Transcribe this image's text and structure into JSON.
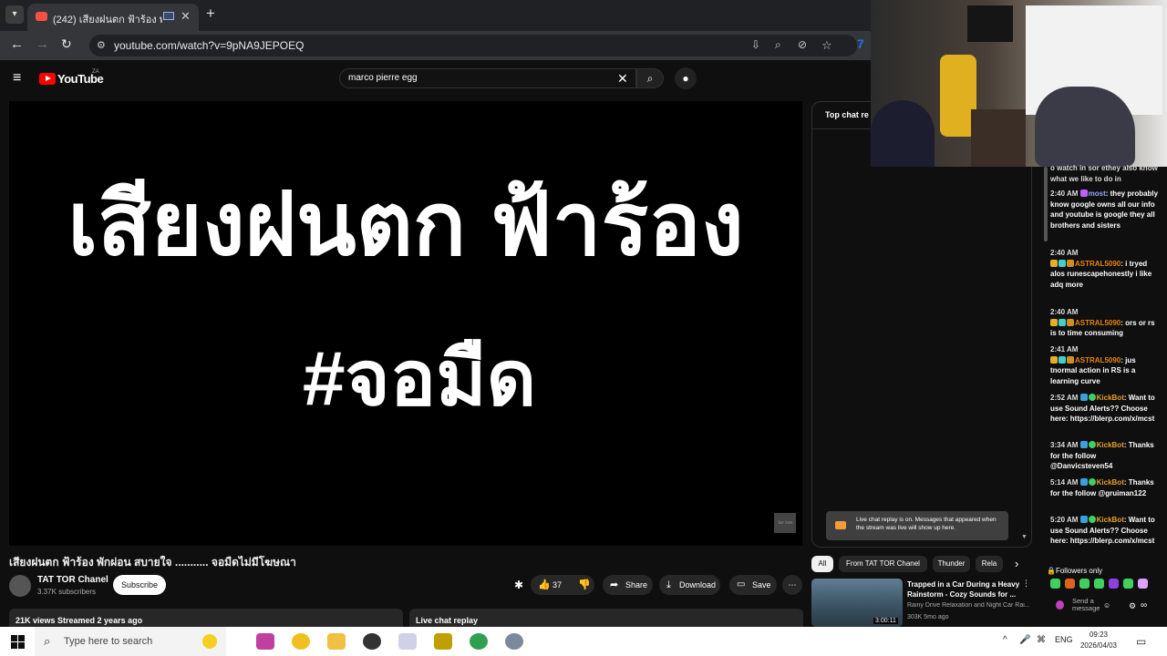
{
  "browser": {
    "tab_title": "(242) เสียงฝนตก ฟ้าร้อง พักผ่อน",
    "url": "youtube.com/watch?v=9pNA9JEPOEQ"
  },
  "youtube": {
    "logo_text": "YouTube",
    "region": "ZA",
    "search_value": "marco pierre egg"
  },
  "video": {
    "overlay_line1": "เสียงฝนตก ฟ้าร้อง",
    "overlay_line2": "#จอมืด",
    "title": "เสียงฝนตก ฟ้าร้อง พักผ่อน สบายใจ ........... จอมืดไม่มีโฆษณา",
    "channel_name": "TAT TOR Chanel",
    "subscribers": "3.37K subscribers",
    "subscribe_label": "Subscribe",
    "like_count": "37",
    "share_label": "Share",
    "download_label": "Download",
    "save_label": "Save",
    "stats": "21K views  Streamed 2 years ago",
    "live_chat_replay_label": "Live chat replay"
  },
  "chat_panel": {
    "header": "Top chat re",
    "replay_notice": "Live chat replay is on. Messages that appeared when the stream was live will show up here."
  },
  "chips": [
    "All",
    "From TAT TOR Chanel",
    "Thunder",
    "Rela"
  ],
  "related": {
    "title": "Trapped in a Car During a Heavy Rainstorm - Cozy Sounds for ...",
    "channel": "Rainy Drive Relaxation and Night Car Rai...",
    "meta": "303K  5mo ago",
    "duration": "3:00:11"
  },
  "kick_chat": {
    "messages": [
      {
        "time": "",
        "user": "",
        "text": "o watch in sor ethey also know what we like to do in"
      },
      {
        "time": "2:40 AM",
        "user": "most",
        "text": "they probably know google owns all our info and youtube is google they all brothers and sisters"
      },
      {
        "time": "2:40 AM",
        "user": "ASTRAL5090",
        "text": "i tryed alos runescapehonestly i like adq more"
      },
      {
        "time": "2:40 AM",
        "user": "ASTRAL5090",
        "text": "ors or rs is to time consuming"
      },
      {
        "time": "2:41 AM",
        "user": "ASTRAL5090",
        "text": "jus tnormal action in RS is a learning curve"
      },
      {
        "time": "2:52 AM",
        "user": "KickBot",
        "text": "Want to use Sound Alerts?? Choose here: https://blerp.com/x/mcst"
      },
      {
        "time": "3:34 AM",
        "user": "KickBot",
        "text": "Thanks for the follow @Danvicsteven54"
      },
      {
        "time": "5:14 AM",
        "user": "KickBot",
        "text": "Thanks for the follow @gruiman122"
      },
      {
        "time": "5:20 AM",
        "user": "KickBot",
        "text": "Want to use Sound Alerts?? Choose here: https://blerp.com/x/mcst"
      }
    ],
    "followers_only": "Followers only",
    "send_placeholder": "Send a message"
  },
  "taskbar": {
    "search_placeholder": "Type here to search",
    "language": "ENG",
    "time": "09:23",
    "date": "2026/04/03"
  },
  "colors": {
    "youtube_red": "#ff0000",
    "kick_username": "#e8820e",
    "chrome_dark": "#202124"
  }
}
